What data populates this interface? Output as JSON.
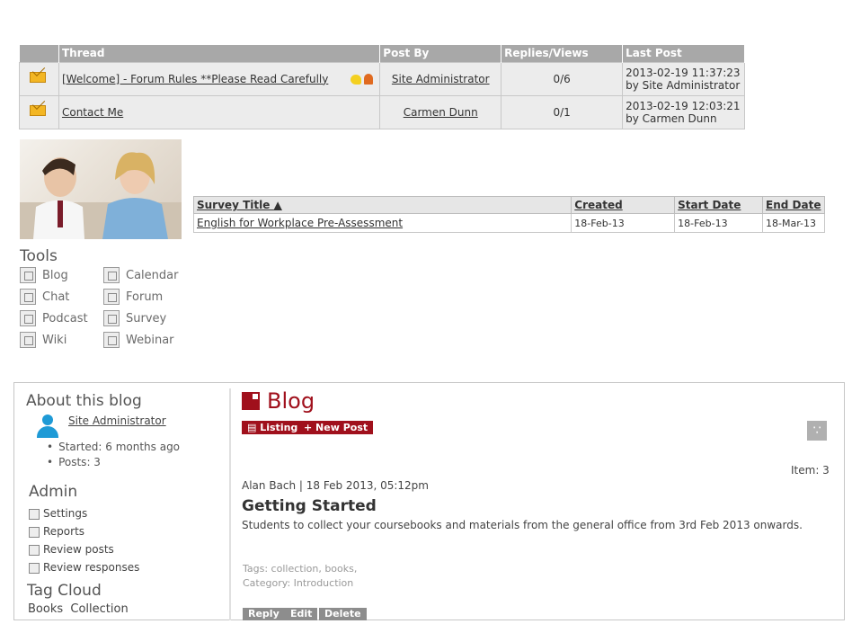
{
  "forum": {
    "headers": [
      "Thread",
      "Post By",
      "Replies/Views",
      "Last Post"
    ],
    "rows": [
      {
        "thread": "[Welcome] - Forum Rules **Please Read Carefully",
        "post_by": "Site Administrator",
        "replies_views": "0/6",
        "last_post_date": "2013-02-19 11:37:23",
        "last_post_by": "by Site Administrator"
      },
      {
        "thread": "Contact Me",
        "post_by": "Carmen Dunn",
        "replies_views": "0/1",
        "last_post_date": "2013-02-19 12:03:21",
        "last_post_by": "by Carmen Dunn"
      }
    ]
  },
  "survey": {
    "headers": [
      "Survey Title ▲",
      "Created",
      "Start Date",
      "End Date"
    ],
    "rows": [
      {
        "title": "English for Workplace Pre-Assessment",
        "created": "18-Feb-13",
        "start": "18-Feb-13",
        "end": "18-Mar-13"
      }
    ]
  },
  "tools": {
    "title": "Tools",
    "items": [
      {
        "label": "Blog",
        "icon": "edit-icon"
      },
      {
        "label": "Calendar",
        "icon": "calendar-icon"
      },
      {
        "label": "Chat",
        "icon": "chat-icon"
      },
      {
        "label": "Forum",
        "icon": "forum-icon"
      },
      {
        "label": "Podcast",
        "icon": "podcast-icon"
      },
      {
        "label": "Survey",
        "icon": "survey-icon"
      },
      {
        "label": "Wiki",
        "icon": "wiki-icon"
      },
      {
        "label": "Webinar",
        "icon": "webinar-icon"
      }
    ]
  },
  "about": {
    "title": "About this blog",
    "author": "Site Administrator",
    "started": "Started: 6 months ago",
    "posts": "Posts: 3"
  },
  "admin": {
    "title": "Admin",
    "items": [
      "Settings",
      "Reports",
      "Review posts",
      "Review responses"
    ]
  },
  "tag_cloud": {
    "title": "Tag Cloud",
    "tags": "Books  Collection"
  },
  "blog": {
    "title": "Blog",
    "listing": "Listing",
    "new_post": "+ New Post",
    "item_count": "Item: 3",
    "post_meta": "Alan Bach | 18 Feb 2013, 05:12pm",
    "post_title": "Getting Started",
    "post_body": "Students to collect your coursebooks and materials from the general office from 3rd Feb 2013 onwards.",
    "tags": "Tags: collection, books,",
    "category": "Category: Introduction",
    "reply": "Reply",
    "edit": "Edit",
    "delete": "Delete"
  },
  "colors": {
    "accent": "#a0101c",
    "header_grey": "#a8a8a8"
  }
}
